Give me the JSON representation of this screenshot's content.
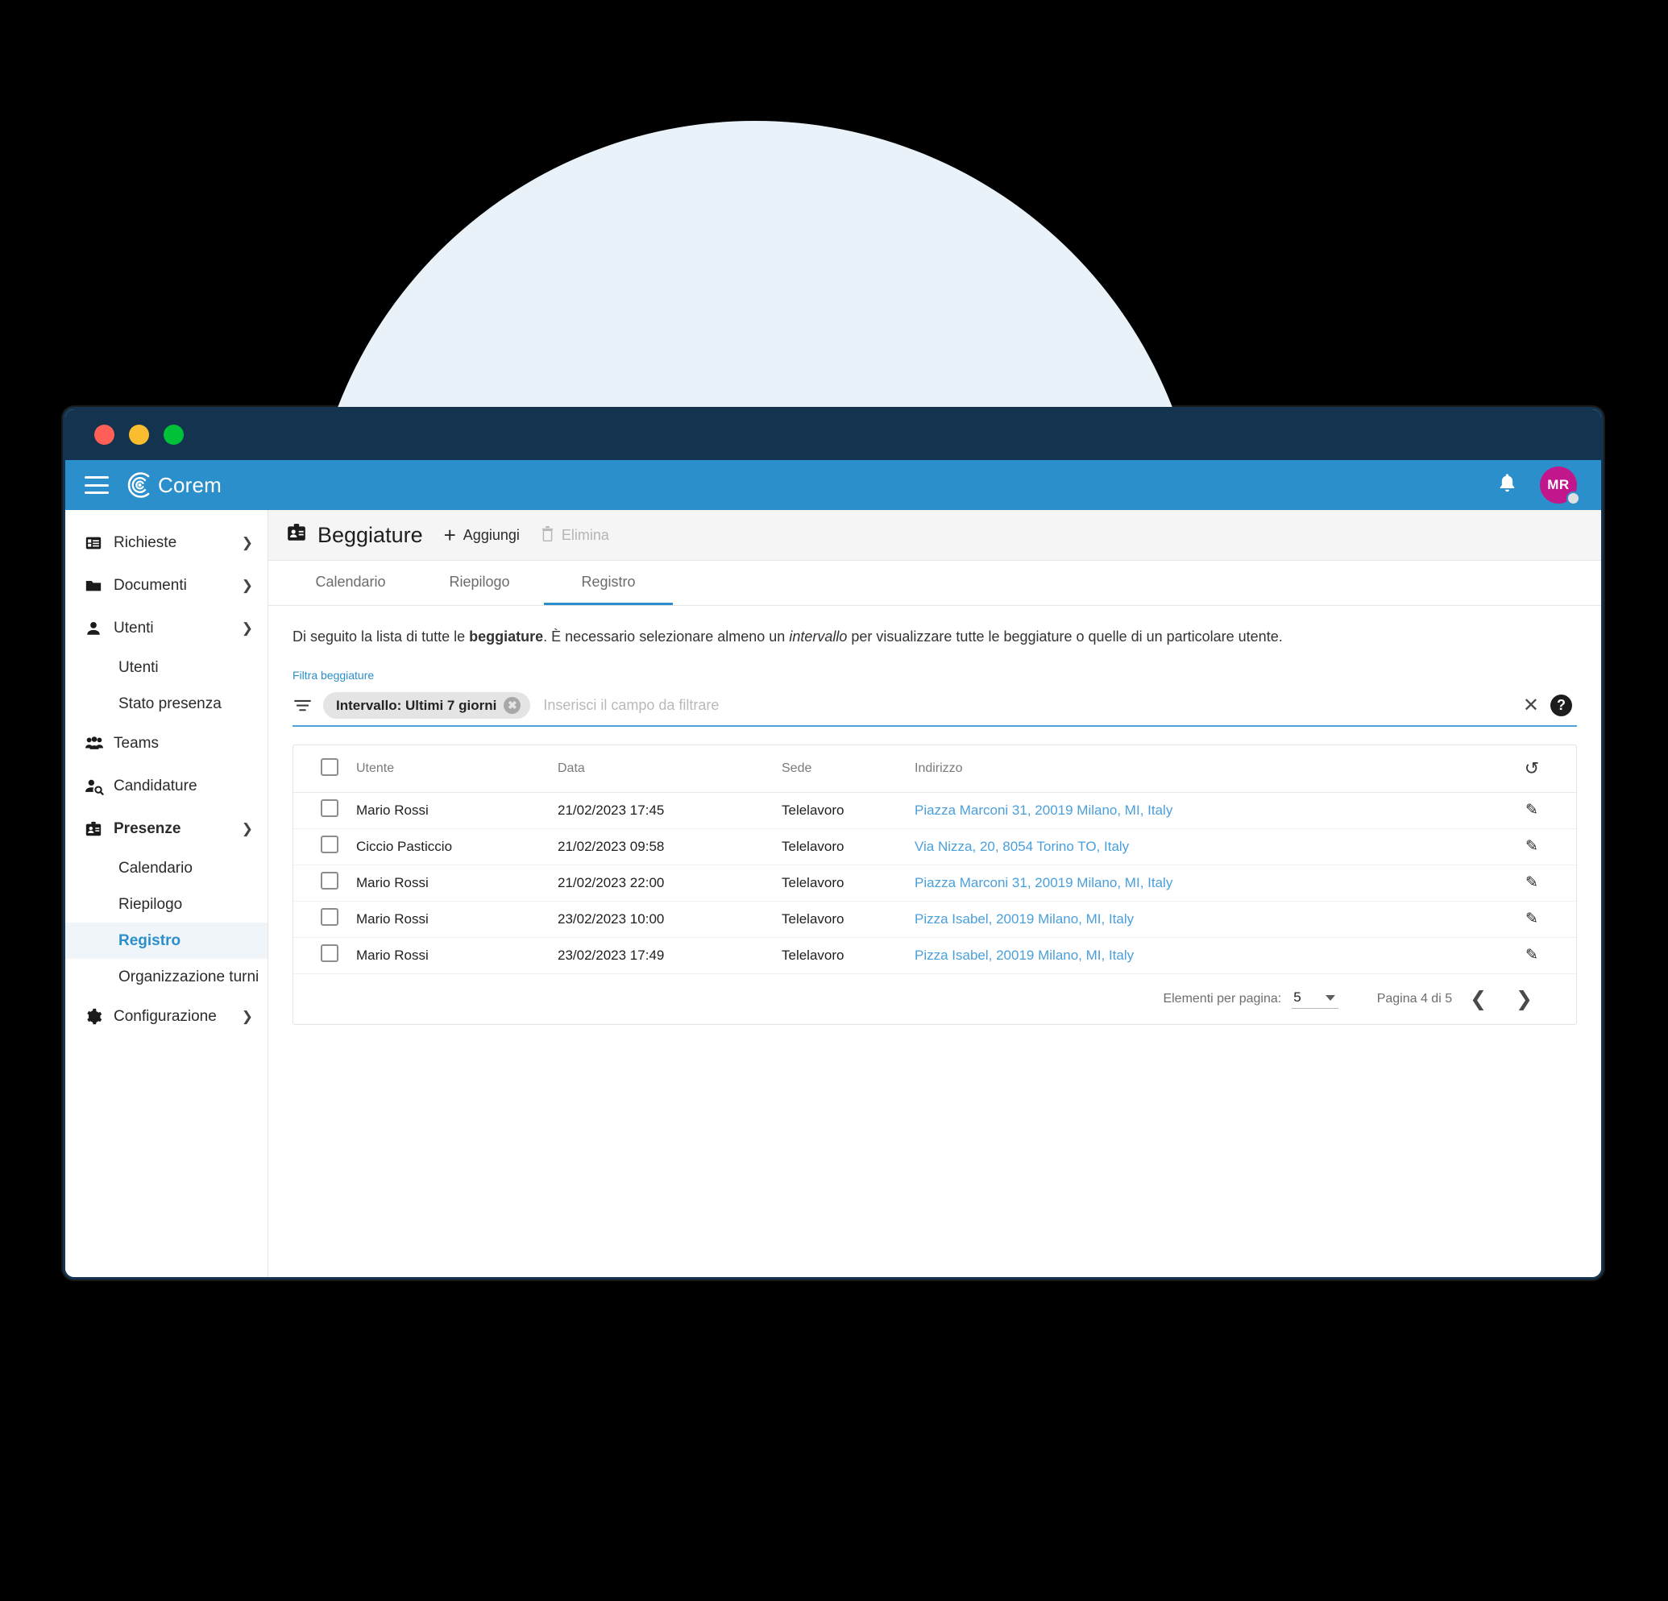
{
  "window": {
    "traffic_lights": [
      "close",
      "minimize",
      "maximize"
    ]
  },
  "appbar": {
    "menu_icon": "hamburger-icon",
    "brand": "Corem",
    "logo_icon": "corem-logo-icon",
    "notifications_icon": "bell-icon",
    "avatar_initials": "MR",
    "accent_color": "#2b8fcb",
    "avatar_color": "#c2168d"
  },
  "sidebar": {
    "items": [
      {
        "label": "Richieste",
        "icon": "list-icon",
        "chevron": "right",
        "type": "group"
      },
      {
        "label": "Documenti",
        "icon": "folder-icon",
        "chevron": "right",
        "type": "group"
      },
      {
        "label": "Utenti",
        "icon": "person-icon",
        "chevron": "down",
        "type": "group"
      },
      {
        "label": "Utenti",
        "type": "sub"
      },
      {
        "label": "Stato presenza",
        "type": "sub"
      },
      {
        "label": "Teams",
        "icon": "people-icon",
        "type": "item"
      },
      {
        "label": "Candidature",
        "icon": "person-search-icon",
        "type": "item"
      },
      {
        "label": "Presenze",
        "icon": "badge-icon",
        "chevron": "down",
        "type": "group",
        "bold": true
      },
      {
        "label": "Calendario",
        "type": "sub"
      },
      {
        "label": "Riepilogo",
        "type": "sub"
      },
      {
        "label": "Registro",
        "type": "sub",
        "active": true
      },
      {
        "label": "Organizzazione turni",
        "type": "sub"
      },
      {
        "label": "Configurazione",
        "icon": "gear-icon",
        "chevron": "right",
        "type": "group"
      }
    ]
  },
  "toolbar": {
    "title": "Beggiature",
    "title_icon": "badge-icon",
    "add_label": "Aggiungi",
    "delete_label": "Elimina",
    "delete_disabled": true
  },
  "tabs": [
    {
      "label": "Calendario",
      "active": false
    },
    {
      "label": "Riepilogo",
      "active": false
    },
    {
      "label": "Registro",
      "active": true
    }
  ],
  "content": {
    "description_part1": "Di seguito la lista di tutte le ",
    "description_bold": "beggiature",
    "description_part2": ". È necessario selezionare almeno un ",
    "description_italic": "intervallo",
    "description_part3": " per visualizzare tutte le beggiature o quelle di un particolare utente."
  },
  "filter": {
    "label": "Filtra beggiature",
    "filter_icon": "filter-icon",
    "chip_label": "Intervallo: Ultimi 7 giorni",
    "chip_remove_icon": "chip-remove-icon",
    "placeholder": "Inserisci il campo da filtrare",
    "value": "",
    "clear_icon": "close-icon",
    "help_icon": "help-icon"
  },
  "table": {
    "refresh_icon": "refresh-icon",
    "columns": [
      "",
      "Utente",
      "Data",
      "Sede",
      "Indirizzo",
      ""
    ],
    "rows": [
      {
        "utente": "Mario Rossi",
        "data": "21/02/2023 17:45",
        "sede": "Telelavoro",
        "indirizzo": "Piazza Marconi 31, 20019 Milano, MI, Italy"
      },
      {
        "utente": "Ciccio Pasticcio",
        "data": "21/02/2023 09:58",
        "sede": "Telelavoro",
        "indirizzo": "Via Nizza, 20, 8054 Torino TO, Italy"
      },
      {
        "utente": "Mario Rossi",
        "data": "21/02/2023 22:00",
        "sede": "Telelavoro",
        "indirizzo": "Piazza Marconi 31, 20019 Milano, MI, Italy"
      },
      {
        "utente": "Mario Rossi",
        "data": "23/02/2023 10:00",
        "sede": "Telelavoro",
        "indirizzo": "Pizza Isabel, 20019 Milano, MI, Italy"
      },
      {
        "utente": "Mario Rossi",
        "data": "23/02/2023 17:49",
        "sede": "Telelavoro",
        "indirizzo": "Pizza Isabel, 20019 Milano, MI, Italy"
      }
    ],
    "row_action_icon": "edit-pencil-icon"
  },
  "pagination": {
    "items_per_page_label": "Elementi per pagina:",
    "items_per_page_value": "5",
    "page_info": "Pagina 4 di 5",
    "prev_icon": "chevron-left-icon",
    "next_icon": "chevron-right-icon"
  }
}
